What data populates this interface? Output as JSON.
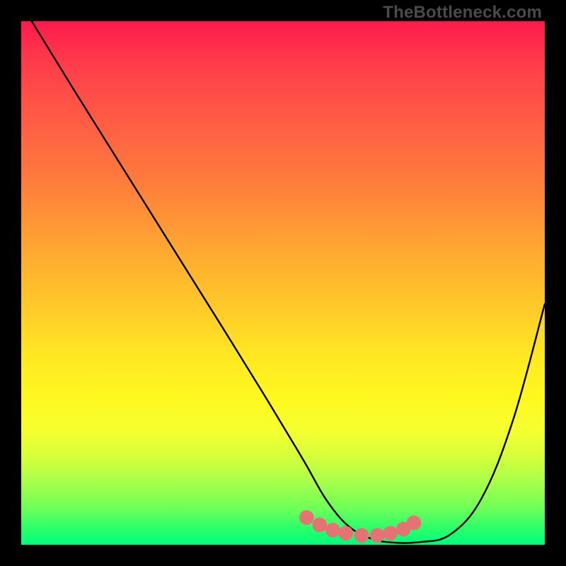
{
  "watermark": "TheBottleneck.com",
  "chart_data": {
    "type": "line",
    "title": "",
    "xlabel": "",
    "ylabel": "",
    "xlim": [
      0,
      100
    ],
    "ylim": [
      0,
      100
    ],
    "series": [
      {
        "name": "curve",
        "color": "#000000",
        "x": [
          2,
          10,
          20,
          30,
          40,
          48,
          54,
          58,
          62,
          66,
          70,
          76,
          82,
          88,
          94,
          100
        ],
        "y": [
          100,
          87,
          71,
          55,
          39,
          26,
          16,
          9,
          4,
          1.5,
          0.5,
          0.5,
          2,
          9,
          24,
          46
        ]
      }
    ],
    "markers": {
      "name": "valley-dots",
      "color": "#e57373",
      "radius_pct": 1.4,
      "x": [
        54.5,
        57,
        59.5,
        62,
        65,
        68,
        70.5,
        73,
        75
      ],
      "y": [
        5.2,
        3.8,
        2.8,
        2.2,
        1.8,
        1.8,
        2.2,
        3.0,
        4.2
      ]
    }
  }
}
